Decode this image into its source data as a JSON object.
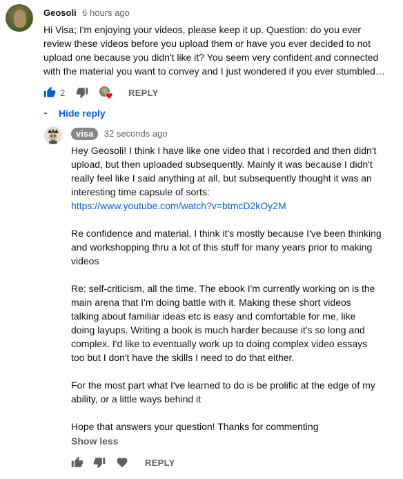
{
  "comment": {
    "author": "Geosoli",
    "time": "6 hours ago",
    "lines": [
      "Hi Visa; I'm enjoying your videos, please keep it up. Question: do you ever",
      "review these videos before you upload them or have you ever decided to not",
      "upload one because you didn't like it? You seem very confident and connected",
      "with the material you want to convey and I just wondered if you ever stumbled…"
    ],
    "like_count": "2",
    "reply_label": "REPLY"
  },
  "toggle": {
    "hide_reply_label": "Hide reply"
  },
  "reply": {
    "author": "visa",
    "time": "32 seconds ago",
    "lines": [
      "Hey Geosoli! I think I have like one video that I recorded and then didn't",
      "upload, but then uploaded subsequently. Mainly it was because I didn't",
      "really feel like I said anything at all, but subsequently thought it was an",
      "interesting time capsule of sorts:"
    ],
    "link": "https://www.youtube.com/watch?v=btmcD2kOy2M",
    "para2": [
      "Re confidence and material, I think it's mostly because I've been thinking",
      "and workshopping thru a lot of this stuff for many years prior to making",
      "videos"
    ],
    "para3": [
      "Re: self-criticism, all the time. The ebook I'm currently working on is the",
      "main arena that I'm doing battle with it. Making these short videos",
      "talking about familiar ideas etc is easy and comfortable for me, like",
      "doing layups. Writing a book is much harder because it's so long and",
      "complex. I'd like to eventually work up to doing complex video essays",
      "too but I don't have the skills I need to do that either."
    ],
    "para4": [
      "For the most part what I've learned to do is be prolific at the edge of my",
      "ability, or a little ways behind it"
    ],
    "para5": "Hope that answers your question! Thanks for commenting",
    "show_less_label": "Show less",
    "reply_label": "REPLY"
  },
  "icons": {
    "like": "thumb-up-icon",
    "dislike": "thumb-down-icon",
    "heart": "heart-icon",
    "collapse": "caret-up-icon"
  },
  "colors": {
    "link": "#065fd4",
    "liked_thumb": "#065fd4",
    "heart": "#ff0000",
    "secondary_text": "#606060",
    "author_badge": "#888888"
  }
}
